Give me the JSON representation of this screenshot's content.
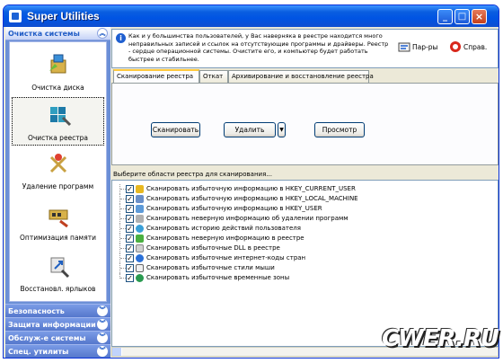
{
  "window": {
    "title": "Super Utilities"
  },
  "sidebar": {
    "header": "Очистка системы",
    "items": [
      {
        "label": "Очистка диска",
        "icon": "disk-cleanup-icon"
      },
      {
        "label": "Очистка реестра",
        "icon": "registry-cleanup-icon"
      },
      {
        "label": "Удаление программ",
        "icon": "uninstall-icon"
      },
      {
        "label": "Оптимизация памяти",
        "icon": "memory-optimization-icon"
      },
      {
        "label": "Восстановл. ярлыков",
        "icon": "shortcut-restore-icon"
      }
    ],
    "sections": [
      {
        "label": "Безопасность"
      },
      {
        "label": "Защита информации"
      },
      {
        "label": "Обслуж-е системы"
      },
      {
        "label": "Спец. утилиты"
      }
    ]
  },
  "info": {
    "text": "Как и у большинства пользователей, у Вас наверняка в реестре находится много неправильных записей и ссылок на отсутствующие программы и драйверы. Реестр - сердце операционной системы. Очистите его, и компьютер будет работать быстрее и стабильнее.",
    "params_label": "Пар-ры",
    "help_label": "Справ."
  },
  "tabs": [
    {
      "label": "Сканирование реестра",
      "active": true
    },
    {
      "label": "Откат",
      "active": false
    },
    {
      "label": "Архивирование и восстановление реестра",
      "active": false
    }
  ],
  "actions": {
    "scan": "Сканировать",
    "delete": "Удалить",
    "view": "Просмотр"
  },
  "list": {
    "header": "Выберите области реестра для сканирования...",
    "items": [
      {
        "label": "Сканировать избыточную информацию в HKEY_CURRENT_USER",
        "checked": true
      },
      {
        "label": "Сканировать избыточную информацию в HKEY_LOCAL_MACHINE",
        "checked": true
      },
      {
        "label": "Сканировать избыточную информацию в HKEY_USER",
        "checked": true
      },
      {
        "label": "Сканировать неверную информацию об удалении программ",
        "checked": true
      },
      {
        "label": "Сканировать историю действий пользователя",
        "checked": true
      },
      {
        "label": "Сканировать неверную информацию в реестре",
        "checked": true
      },
      {
        "label": "Сканировать избыточные DLL в реестре",
        "checked": true
      },
      {
        "label": "Сканировать избыточные интернет-коды стран",
        "checked": true
      },
      {
        "label": "Сканировать избыточные стили мыши",
        "checked": true
      },
      {
        "label": "Сканировать избыточные временные зоны",
        "checked": true
      }
    ]
  },
  "watermark": "CWER.RU",
  "colors": {
    "titlebar": "#0054e3",
    "sidebar": "#6b8fd6",
    "accent_tab": "#ffc83c"
  }
}
